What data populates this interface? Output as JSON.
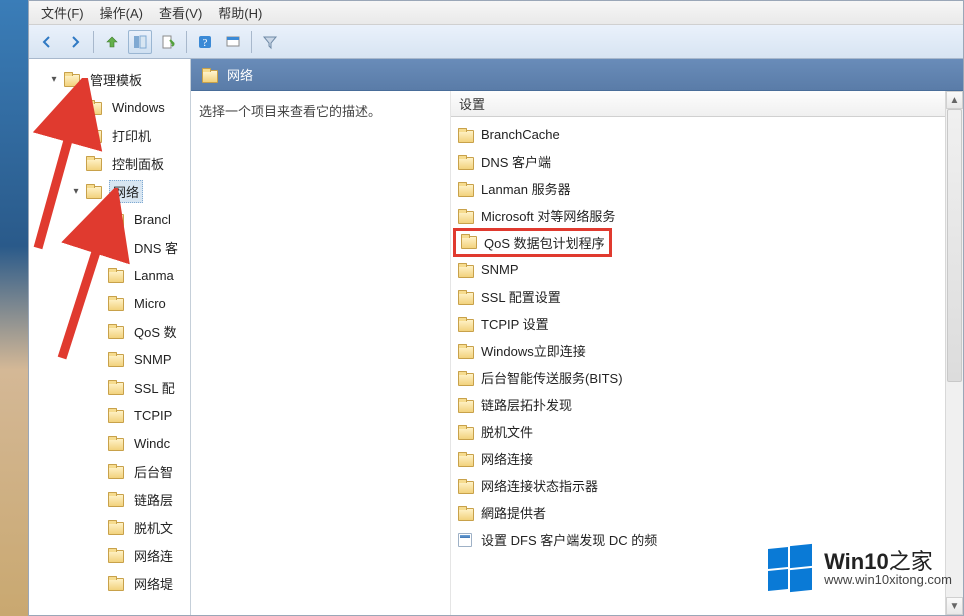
{
  "menubar": {
    "file": "文件(F)",
    "action": "操作(A)",
    "view": "查看(V)",
    "help": "帮助(H)"
  },
  "toolbar": {
    "icons": {
      "back": "back-arrow",
      "forward": "forward-arrow",
      "up": "up-level",
      "selected": "show-hide-tree",
      "export": "export-list",
      "help": "help",
      "properties": "properties",
      "filter": "filter"
    }
  },
  "tree": [
    {
      "level": 0,
      "expander": "▾",
      "label": "管理模板",
      "name": "admin-templates"
    },
    {
      "level": 1,
      "expander": "",
      "label": "Windows",
      "name": "windows-folder"
    },
    {
      "level": 1,
      "expander": "",
      "label": "打印机",
      "name": "printers"
    },
    {
      "level": 1,
      "expander": "",
      "label": "控制面板",
      "name": "control-panel"
    },
    {
      "level": 1,
      "expander": "▾",
      "label": "网络",
      "name": "network-folder",
      "selected": true
    },
    {
      "level": 2,
      "expander": "",
      "label": "Brancl",
      "name": "branchcache"
    },
    {
      "level": 2,
      "expander": "",
      "label": "DNS 客",
      "name": "dns-client"
    },
    {
      "level": 2,
      "expander": "",
      "label": "Lanma",
      "name": "lanman"
    },
    {
      "level": 2,
      "expander": "",
      "label": "Micro",
      "name": "microsoft"
    },
    {
      "level": 2,
      "expander": "",
      "label": "QoS 数",
      "name": "qos"
    },
    {
      "level": 2,
      "expander": "",
      "label": "SNMP",
      "name": "snmp"
    },
    {
      "level": 2,
      "expander": "",
      "label": "SSL 配",
      "name": "ssl"
    },
    {
      "level": 2,
      "expander": "",
      "label": "TCPIP",
      "name": "tcpip"
    },
    {
      "level": 2,
      "expander": "",
      "label": "Windc",
      "name": "win-inst"
    },
    {
      "level": 2,
      "expander": "",
      "label": "后台智",
      "name": "bits"
    },
    {
      "level": 2,
      "expander": "",
      "label": "链路层",
      "name": "link-layer"
    },
    {
      "level": 2,
      "expander": "",
      "label": "脱机文",
      "name": "offline"
    },
    {
      "level": 2,
      "expander": "",
      "label": "网络连",
      "name": "net-conn"
    },
    {
      "level": 2,
      "expander": "",
      "label": "网络堤",
      "name": "net-prov"
    }
  ],
  "right": {
    "header": "网络",
    "desc": "选择一个项目来查看它的描述。",
    "settingHeader": "设置",
    "items": [
      {
        "label": "BranchCache",
        "type": "folder"
      },
      {
        "label": "DNS 客户端",
        "type": "folder"
      },
      {
        "label": "Lanman 服务器",
        "type": "folder"
      },
      {
        "label": "Microsoft 对等网络服务",
        "type": "folder"
      },
      {
        "label": "QoS 数据包计划程序",
        "type": "folder",
        "highlighted": true
      },
      {
        "label": "SNMP",
        "type": "folder"
      },
      {
        "label": "SSL 配置设置",
        "type": "folder"
      },
      {
        "label": "TCPIP 设置",
        "type": "folder"
      },
      {
        "label": "Windows立即连接",
        "type": "folder"
      },
      {
        "label": "后台智能传送服务(BITS)",
        "type": "folder"
      },
      {
        "label": "链路层拓扑发现",
        "type": "folder"
      },
      {
        "label": "脱机文件",
        "type": "folder"
      },
      {
        "label": "网络连接",
        "type": "folder"
      },
      {
        "label": "网络连接状态指示器",
        "type": "folder"
      },
      {
        "label": "網路提供者",
        "type": "folder"
      },
      {
        "label": "设置 DFS 客户端发现 DC 的频",
        "type": "setting"
      }
    ]
  },
  "watermark": {
    "brand_top": "Win10",
    "brand_suffix": "之家",
    "url": "www.win10xitong.com"
  },
  "colors": {
    "highlight_border": "#e03a2f",
    "header_bg_start": "#698cb9",
    "header_bg_end": "#5a7ca8"
  }
}
